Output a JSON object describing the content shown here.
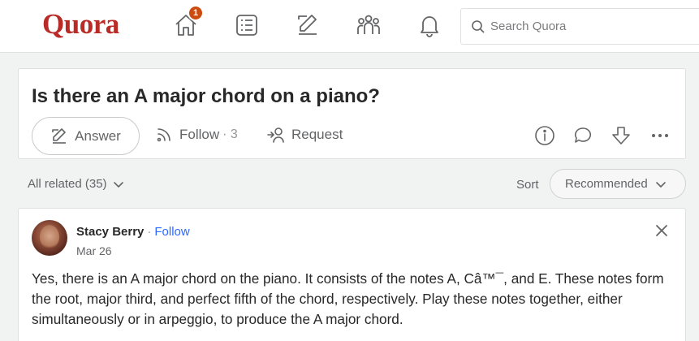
{
  "header": {
    "logo": "Quora",
    "notification_badge": "1",
    "search_placeholder": "Search Quora"
  },
  "question": {
    "title": "Is there an A major chord on a piano?",
    "answer_label": "Answer",
    "follow_label": "Follow",
    "follow_count": "3",
    "request_label": "Request"
  },
  "filter": {
    "related_label": "All related (35)",
    "sort_label": "Sort",
    "sort_value": "Recommended"
  },
  "answer": {
    "author": "Stacy Berry",
    "separator": "·",
    "follow_label": "Follow",
    "date": "Mar 26",
    "text": "Yes, there is an A major chord on the piano. It consists of the notes A, Câ™¯, and E. These notes form the root, major third, and perfect fifth of the chord, respectively. Play these notes together, either simultaneously or in arpeggio, to produce the A major chord."
  },
  "colors": {
    "brand": "#b92b27",
    "link": "#2e69ff",
    "badge": "#cb4b10"
  }
}
